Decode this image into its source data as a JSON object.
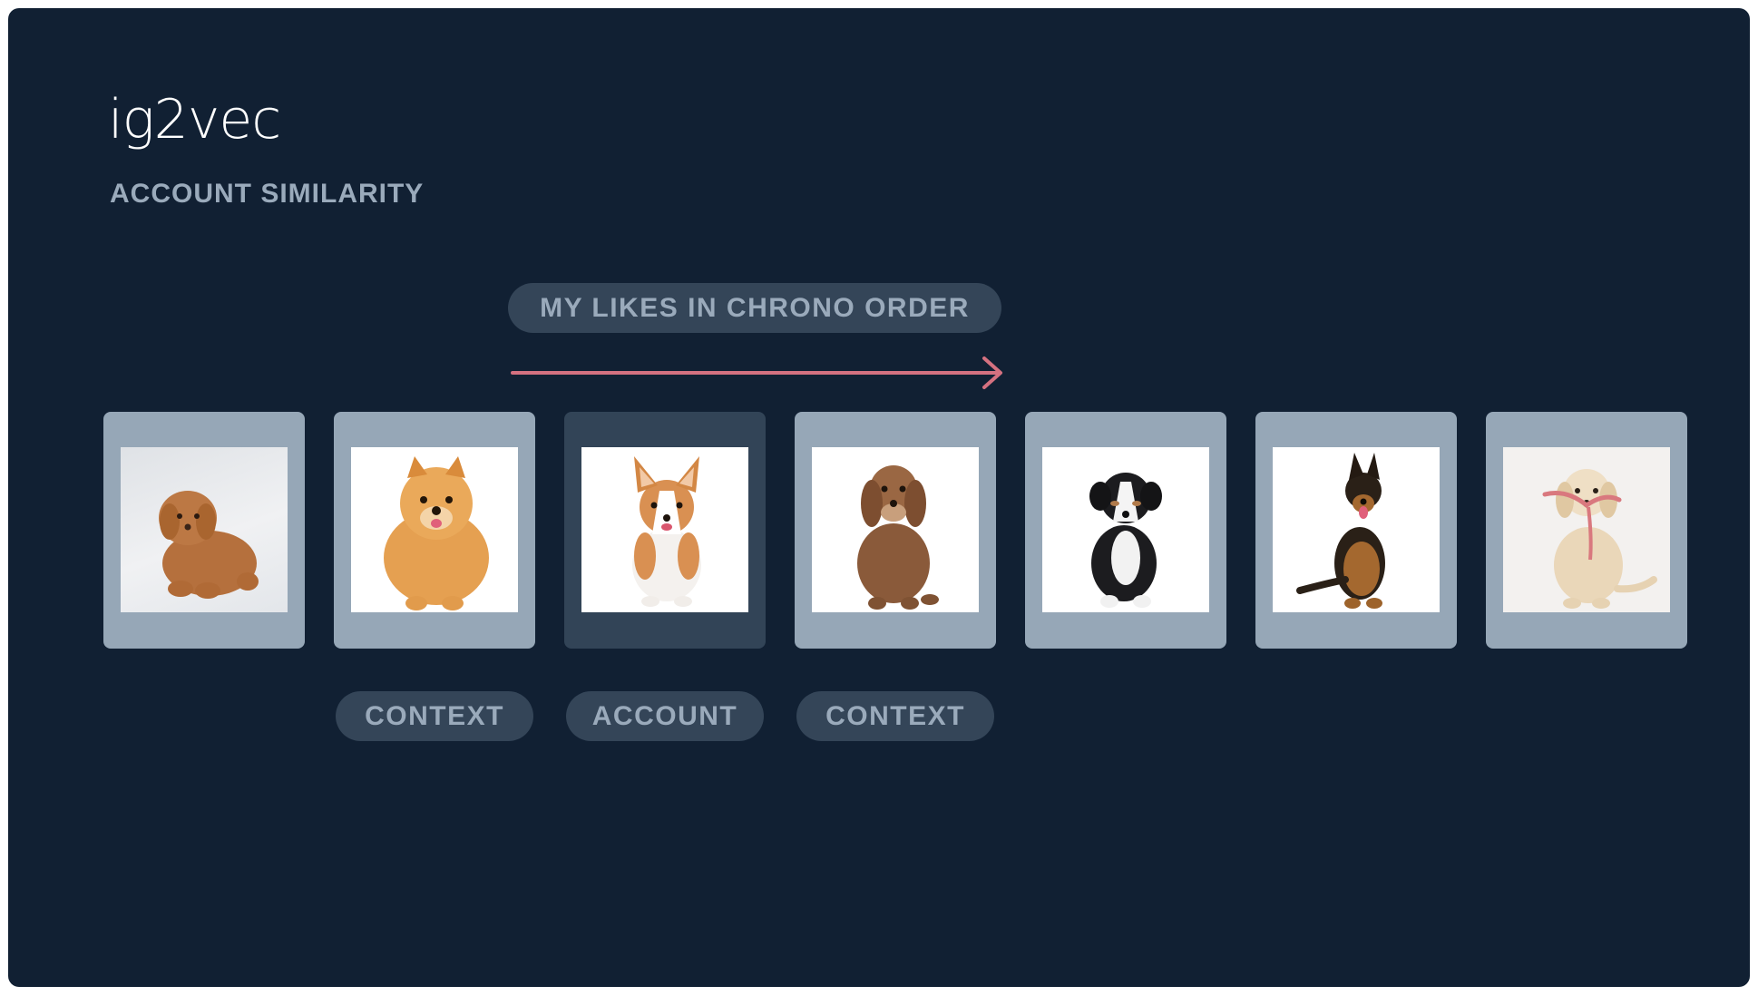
{
  "title": "ig2vec",
  "subtitle": "ACCOUNT SIMILARITY",
  "likes_label": "MY LIKES IN CHRONO ORDER",
  "colors": {
    "background": "#112033",
    "card": "#96a7b7",
    "card_highlight": "#324457",
    "pill": "#344558",
    "pill_text": "#9aaabb",
    "arrow": "#d47180"
  },
  "cards": [
    {
      "image": "toy-poodle-puppy-photo"
    },
    {
      "image": "pomeranian-photo"
    },
    {
      "image": "corgi-photo",
      "highlight": true
    },
    {
      "image": "cavapoo-puppy-photo"
    },
    {
      "image": "australian-shepherd-puppy-photo"
    },
    {
      "image": "german-shepherd-puppy-photo"
    },
    {
      "image": "golden-retriever-puppy-photo"
    }
  ],
  "labels": {
    "left_context": "CONTEXT",
    "account": "ACCOUNT",
    "right_context": "CONTEXT"
  }
}
